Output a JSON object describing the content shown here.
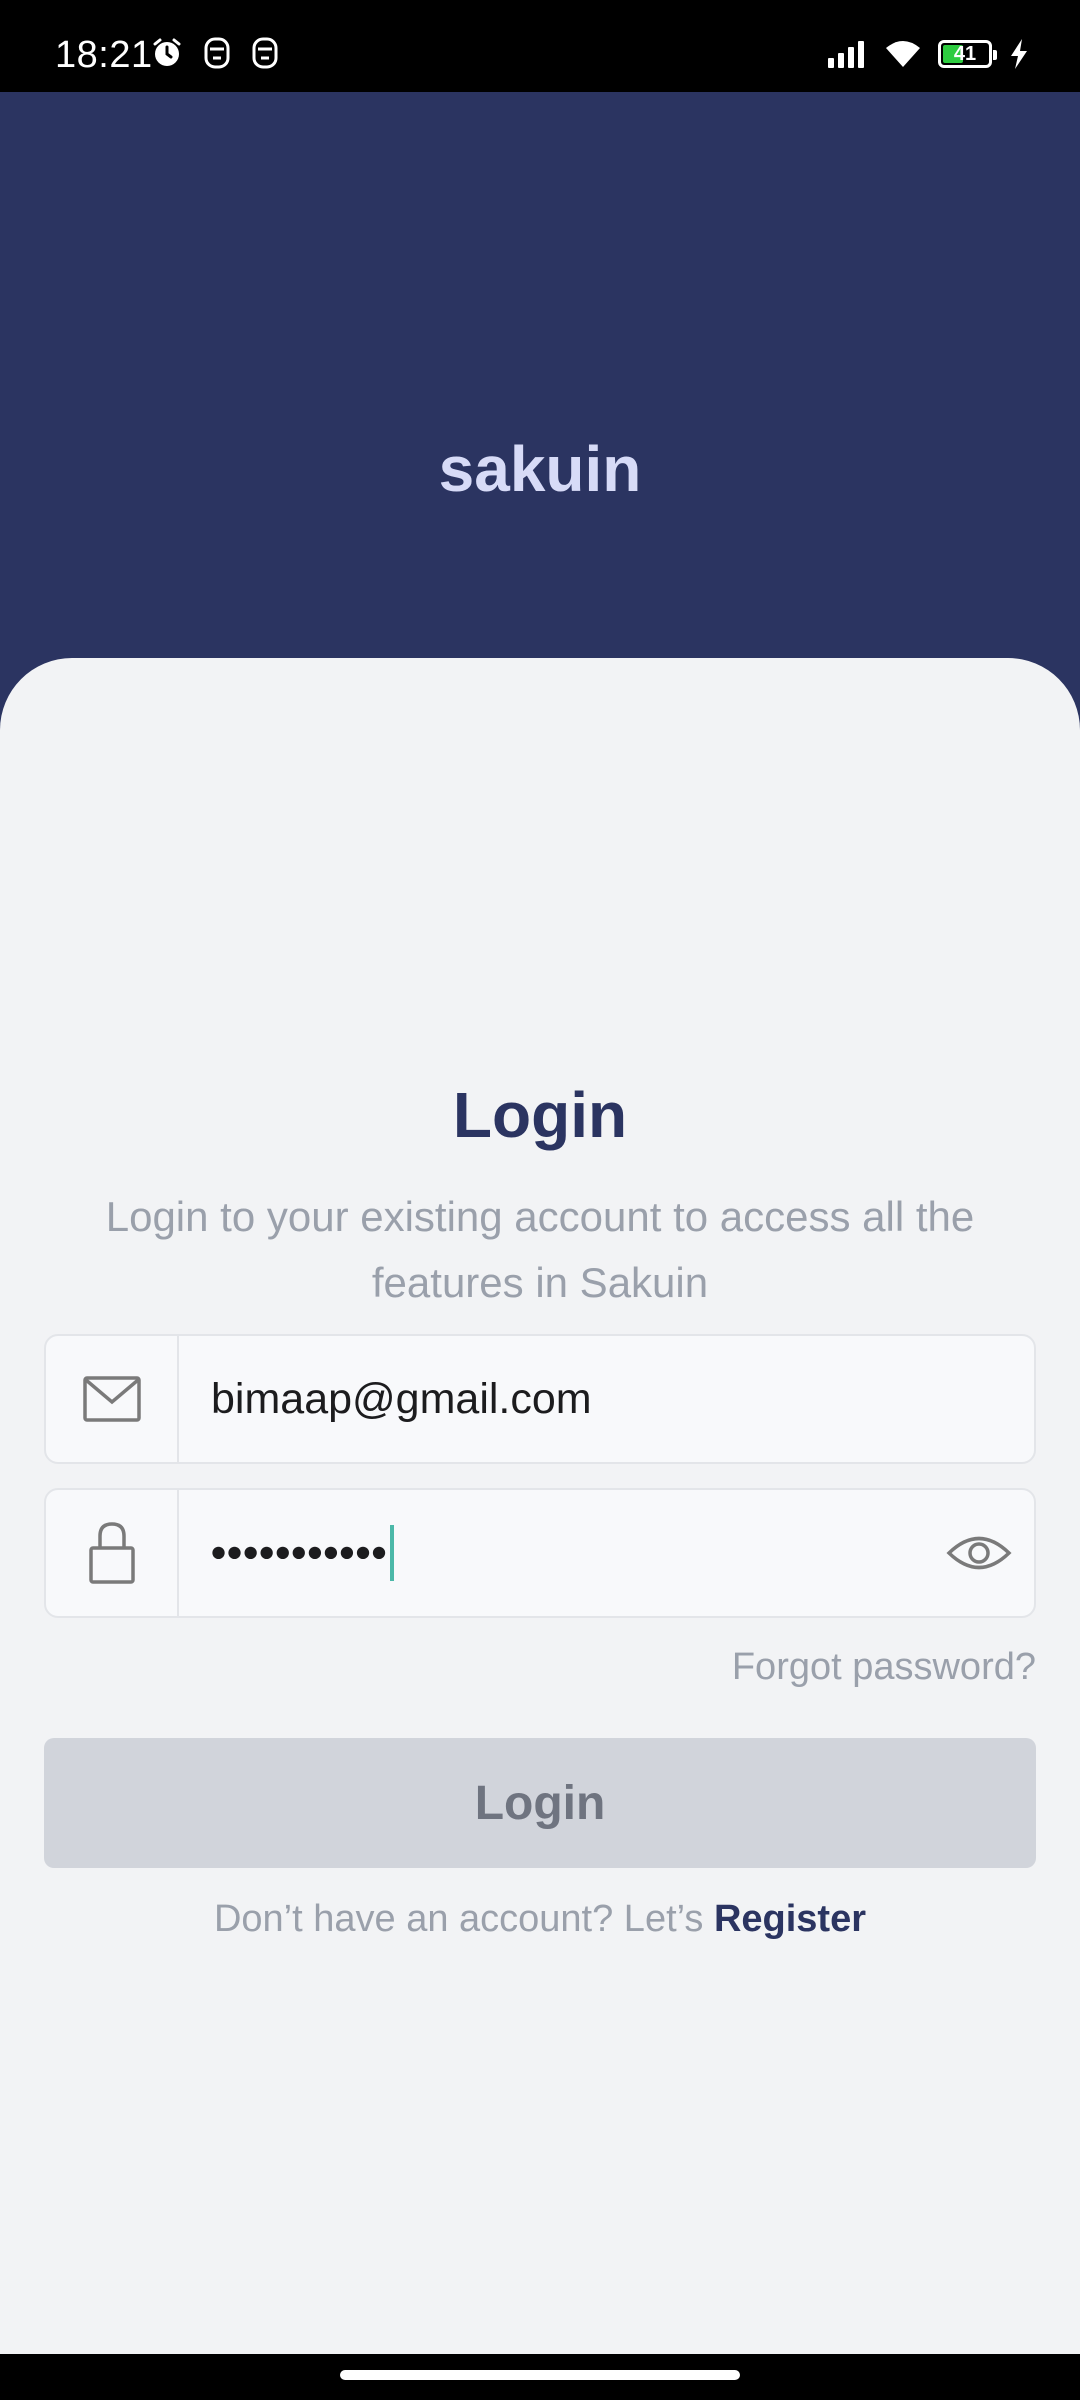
{
  "status_bar": {
    "time": "18:21",
    "battery": "41",
    "battery_fill_percent": 41,
    "left_icons": [
      "alarm-icon",
      "face-icon",
      "face-icon"
    ],
    "right_icons": [
      "signal-icon",
      "wifi-icon",
      "battery-icon",
      "charging-icon"
    ]
  },
  "header": {
    "brand": "sakuin"
  },
  "login": {
    "title": "Login",
    "subtitle": "Login to your existing account to access all the features in Sakuin",
    "email": {
      "icon": "mail-icon",
      "value": "bimaap@gmail.com"
    },
    "password": {
      "icon": "lock-icon",
      "value": "•••••••••••",
      "toggle_icon": "eye-icon"
    },
    "forgot_label": "Forgot password?",
    "login_button": "Login",
    "register_prompt": "Don’t have an account? Let’s ",
    "register_link": "Register"
  },
  "colors": {
    "header_bg": "#2b3461",
    "brand_text": "#d7dbf7",
    "sheet_bg": "#f2f3f5",
    "accent": "#2b3461",
    "muted_text": "#9aa0ab",
    "button_disabled": "#d1d4db",
    "caret": "#4cb8a8"
  }
}
